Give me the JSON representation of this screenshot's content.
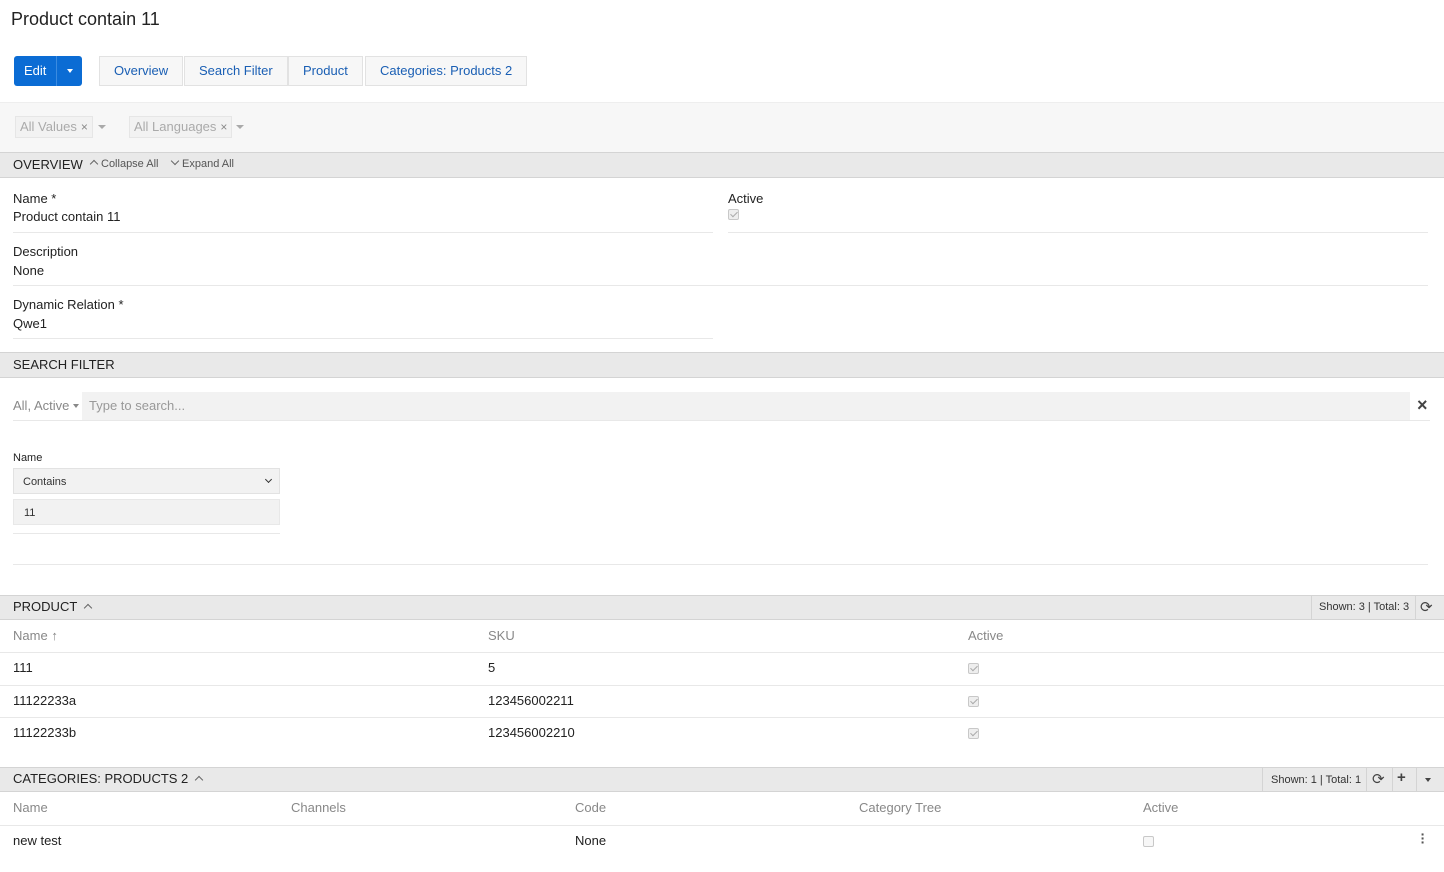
{
  "page": {
    "title": "Product contain 11"
  },
  "toolbar": {
    "edit_label": "Edit",
    "tabs": [
      {
        "label": "Overview"
      },
      {
        "label": "Search Filter"
      },
      {
        "label": "Product"
      },
      {
        "label": "Categories: Products 2"
      }
    ]
  },
  "filters": {
    "values_chip": "All Values",
    "languages_chip": "All Languages"
  },
  "overview": {
    "header": "OVERVIEW",
    "collapse_all": "Collapse All",
    "expand_all": "Expand All",
    "fields": {
      "name_label": "Name *",
      "name_value": "Product contain 11",
      "active_label": "Active",
      "active_checked": true,
      "description_label": "Description",
      "description_value": "None",
      "dynamic_relation_label": "Dynamic Relation *",
      "dynamic_relation_value": "Qwe1"
    }
  },
  "search_filter": {
    "header": "SEARCH FILTER",
    "scope": "All, Active",
    "search_placeholder": "Type to search...",
    "name_label": "Name",
    "operator": "Contains",
    "value": "11"
  },
  "product": {
    "header": "PRODUCT",
    "counter": "Shown: 3 | Total: 3",
    "columns": {
      "name": "Name",
      "sku": "SKU",
      "active": "Active"
    },
    "rows": [
      {
        "name": "111",
        "sku": "5",
        "active": true
      },
      {
        "name": "11122233a",
        "sku": "123456002211",
        "active": true
      },
      {
        "name": "11122233b",
        "sku": "123456002210",
        "active": true
      }
    ]
  },
  "categories": {
    "header": "CATEGORIES: PRODUCTS 2",
    "counter": "Shown: 1 | Total: 1",
    "columns": {
      "name": "Name",
      "channels": "Channels",
      "code": "Code",
      "category_tree": "Category Tree",
      "active": "Active"
    },
    "rows": [
      {
        "name": "new test",
        "channels": "",
        "code": "None",
        "category_tree": "",
        "active": false
      }
    ]
  },
  "icons": {
    "refresh": "refresh-icon",
    "add": "plus-icon",
    "menu": "kebab-icon",
    "sort": "sort-asc-icon",
    "clear": "close-icon"
  }
}
